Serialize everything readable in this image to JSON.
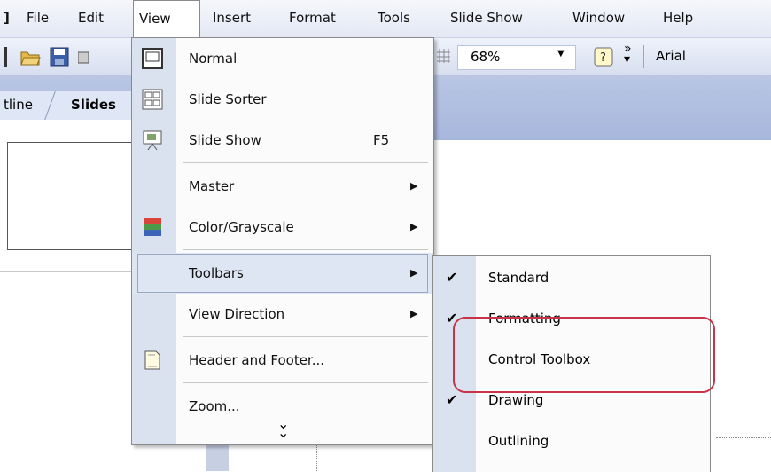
{
  "menubar": {
    "items": [
      {
        "label": "File"
      },
      {
        "label": "Edit"
      },
      {
        "label": "View"
      },
      {
        "label": "Insert"
      },
      {
        "label": "Format"
      },
      {
        "label": "Tools"
      },
      {
        "label": "Slide Show"
      },
      {
        "label": "Window"
      },
      {
        "label": "Help"
      }
    ]
  },
  "toolbar": {
    "zoom_value": "68%",
    "font_value": "Arial"
  },
  "panes": {
    "tab_outline": "tline",
    "tab_slides": "Slides"
  },
  "view_menu": {
    "items": [
      {
        "label": "Normal"
      },
      {
        "label": "Slide Sorter"
      },
      {
        "label": "Slide Show",
        "shortcut": "F5"
      },
      {
        "label": "Master",
        "submenu": "▶"
      },
      {
        "label": "Color/Grayscale",
        "submenu": "▶"
      },
      {
        "label": "Toolbars",
        "submenu": "▶"
      },
      {
        "label": "View Direction",
        "submenu": "▶"
      },
      {
        "label": "Header and Footer..."
      },
      {
        "label": "Zoom..."
      }
    ],
    "expand_glyph": "⌄"
  },
  "toolbars_submenu": {
    "items": [
      {
        "label": "Standard",
        "checked": true
      },
      {
        "label": "Formatting",
        "checked": true
      },
      {
        "label": "Control Toolbox",
        "checked": false
      },
      {
        "label": "Drawing",
        "checked": true
      },
      {
        "label": "Outlining",
        "checked": false
      }
    ],
    "check_glyph": "✔"
  },
  "colors": {
    "annotation_red": "#c8334a",
    "menu_highlight": "#dfe6f3"
  }
}
